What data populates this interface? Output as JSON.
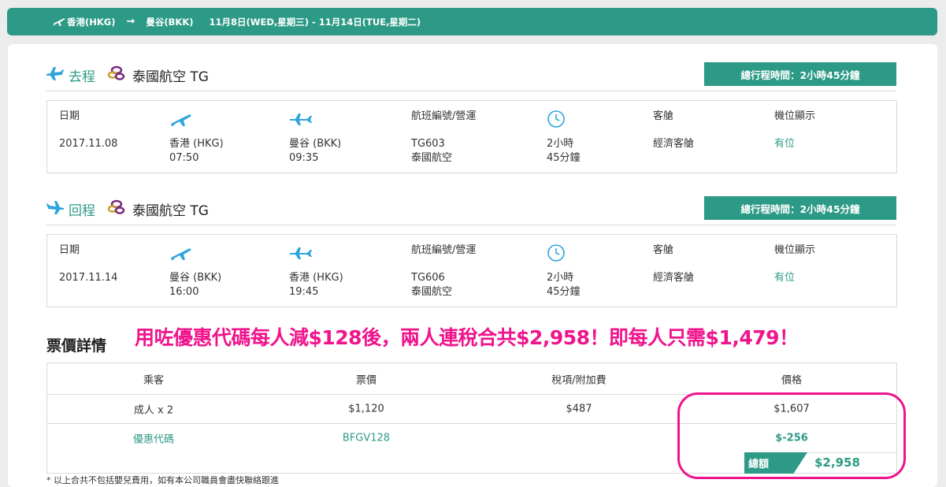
{
  "topbar": {
    "origin": "香港(HKG)",
    "arrow": "→",
    "destination": "曼谷(BKK)",
    "dates": "11月8日(WED,星期三) - 11月14日(TUE,星期二)"
  },
  "outbound": {
    "direction": "去程",
    "airline": "泰國航空 TG",
    "duration_badge": "總行程時間：2小時45分鐘",
    "headers": {
      "date": "日期",
      "flight": "航班編號/營運",
      "cabin": "客艙",
      "seat": "機位顯示"
    },
    "date": "2017.11.08",
    "dep_city": "香港 (HKG)",
    "dep_time": "07:50",
    "arr_city": "曼谷 (BKK)",
    "arr_time": "09:35",
    "flight_no": "TG603",
    "operator": "泰國航空",
    "dur_line1": "2小時",
    "dur_line2": "45分鐘",
    "cabin": "經濟客艙",
    "seat": "有位"
  },
  "return": {
    "direction": "回程",
    "airline": "泰國航空 TG",
    "duration_badge": "總行程時間：2小時45分鐘",
    "headers": {
      "date": "日期",
      "flight": "航班編號/營運",
      "cabin": "客艙",
      "seat": "機位顯示"
    },
    "date": "2017.11.14",
    "dep_city": "曼谷 (BKK)",
    "dep_time": "16:00",
    "arr_city": "香港 (HKG)",
    "arr_time": "19:45",
    "flight_no": "TG606",
    "operator": "泰國航空",
    "dur_line1": "2小時",
    "dur_line2": "45分鐘",
    "cabin": "經濟客艙",
    "seat": "有位"
  },
  "price": {
    "title": "票價詳情",
    "promo_banner": "用咗優惠代碼每人減$128後，兩人連稅合共$2,958！即每人只需$1,479！",
    "headers": {
      "passenger": "乘客",
      "fare": "票價",
      "tax": "稅項/附加費",
      "price": "價格"
    },
    "adult_row": {
      "passenger": "成人 x 2",
      "fare": "$1,120",
      "tax": "$487",
      "price": "$1,607"
    },
    "promo_row": {
      "label": "優惠代碼",
      "code": "BFGV128",
      "discount": "$-256"
    },
    "total_label": "總額",
    "total_amount": "$2,958"
  },
  "footnote": "* 以上合共不包括嬰兒費用，如有本公司職員會盡快聯絡跟進",
  "colors": {
    "accent": "#2c9a86",
    "plane_icon": "#2ea5dc",
    "highlight": "#f0148c",
    "logo": "#7a2a7c"
  }
}
